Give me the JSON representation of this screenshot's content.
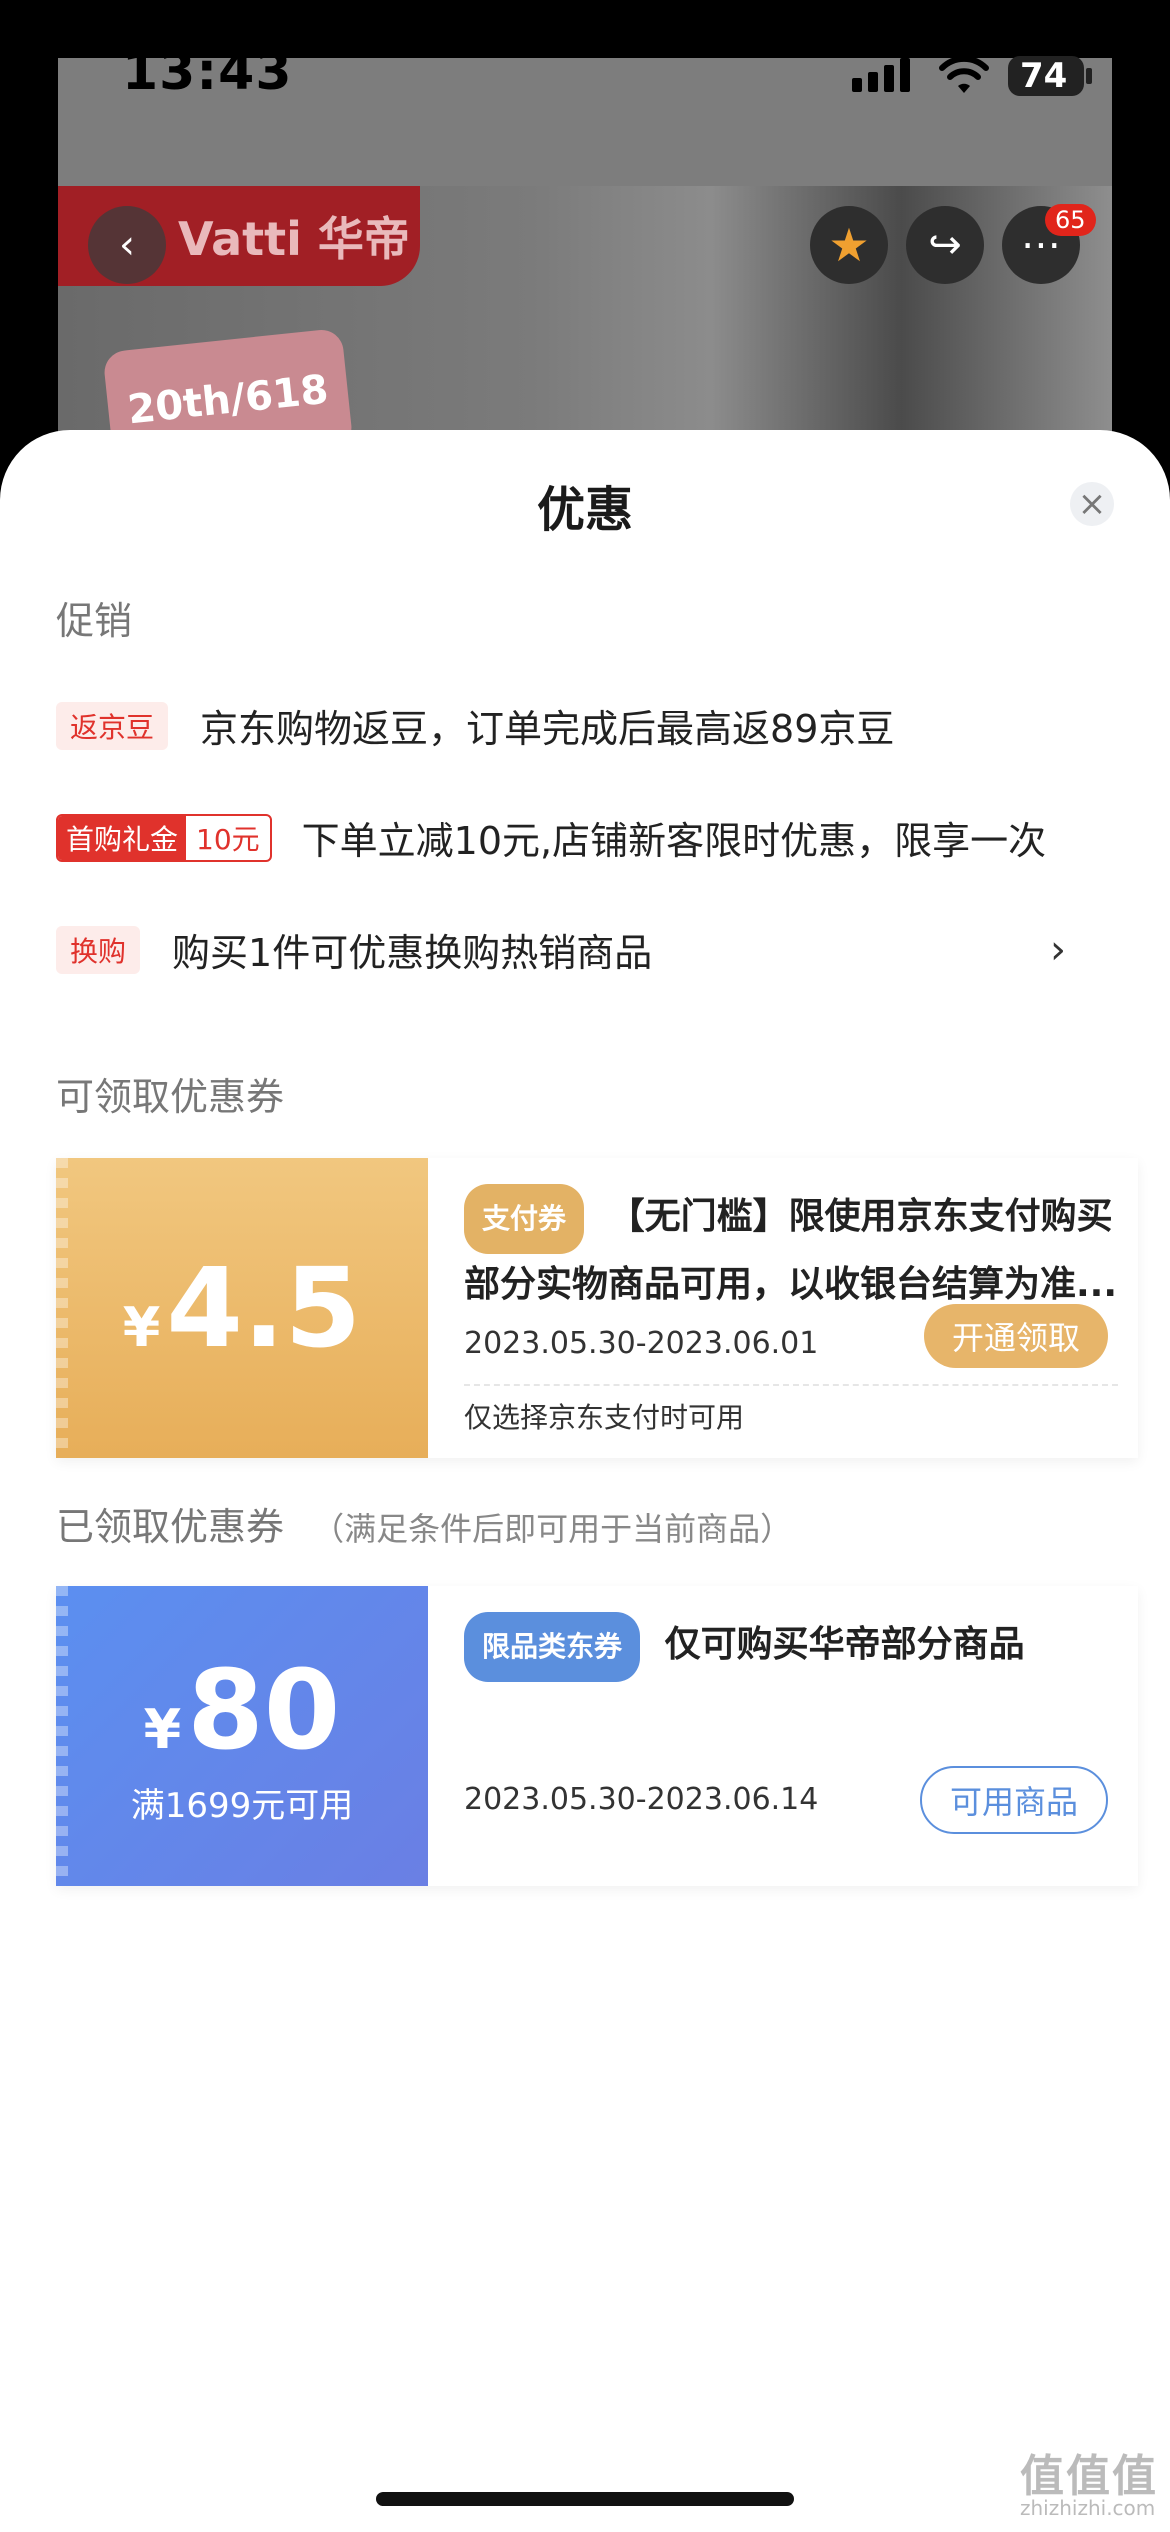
{
  "status_bar": {
    "time": "13:43",
    "battery": "74"
  },
  "header": {
    "brand": "Vatti 华帝",
    "cart_count": "65",
    "promo_text": "20th/618"
  },
  "sheet": {
    "title": "优惠"
  },
  "promotions": {
    "section_label": "促销",
    "items": [
      {
        "tag": "返京豆",
        "text": "京东购物返豆，订单完成后最高返89京豆"
      },
      {
        "tag_left": "首购礼金",
        "tag_right": "10元",
        "text": "下单立减10元,店铺新客限时优惠，限享一次"
      },
      {
        "tag": "换购",
        "text": "购买1件可优惠换购热销商品",
        "chevron": "›"
      }
    ]
  },
  "available": {
    "section_label": "可领取优惠券",
    "coupon": {
      "currency": "¥",
      "amount": "4.5",
      "tag": "支付券",
      "title": "【无门槛】限使用京东支付购买部分实物商品可用，以收银台结算为准...",
      "date": "2023.05.30-2023.06.01",
      "button": "开通领取",
      "note": "仅选择京东支付时可用"
    }
  },
  "claimed": {
    "section_label": "已领取优惠券",
    "section_hint": "（满足条件后即可用于当前商品）",
    "coupon": {
      "currency": "¥",
      "amount": "80",
      "condition": "满1699元可用",
      "tag": "限品类东券",
      "title": "仅可购买华帝部分商品",
      "date": "2023.05.30-2023.06.14",
      "button": "可用商品"
    }
  },
  "watermark": {
    "text": "值值值",
    "url": "zhizhizhi.com"
  },
  "colors": {
    "red": "#e0322c",
    "gold": "#e7ae59",
    "blue": "#5b8ff0"
  }
}
